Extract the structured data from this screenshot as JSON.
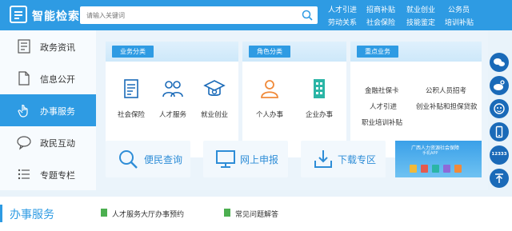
{
  "header": {
    "title": "智能检索",
    "search_placeholder": "请输入关键词",
    "links": [
      "人才引进",
      "招商补贴",
      "就业创业",
      "公务员",
      "劳动关系",
      "社会保险",
      "技能鉴定",
      "培训补贴"
    ]
  },
  "leftnav": {
    "items": [
      {
        "label": "政务资讯",
        "icon": "document-list-icon"
      },
      {
        "label": "信息公开",
        "icon": "file-icon"
      },
      {
        "label": "办事服务",
        "icon": "hand-pointer-icon"
      },
      {
        "label": "政民互动",
        "icon": "chat-bubble-icon"
      },
      {
        "label": "专题专栏",
        "icon": "list-icon"
      }
    ],
    "active": "办事服务"
  },
  "sections": {
    "business": {
      "tag": "业务分类",
      "items": [
        {
          "label": "社会保险",
          "icon": "insurance-doc-icon"
        },
        {
          "label": "人才服务",
          "icon": "people-group-icon"
        },
        {
          "label": "就业创业",
          "icon": "graduate-cap-icon"
        }
      ]
    },
    "role": {
      "tag": "角色分类",
      "items": [
        {
          "label": "个人办事",
          "icon": "person-icon"
        },
        {
          "label": "企业办事",
          "icon": "building-icon"
        }
      ]
    },
    "key": {
      "tag": "重点业务",
      "items": [
        "金融社保卡",
        "公积人员招考",
        "人才引进",
        "创业补贴和担保贷款",
        "职业培训补贴"
      ]
    }
  },
  "quick": [
    {
      "label": "便民查询",
      "icon": "search-icon"
    },
    {
      "label": "网上申报",
      "icon": "computer-icon"
    },
    {
      "label": "下载专区",
      "icon": "download-icon"
    }
  ],
  "banner": {
    "title": "广西人力资源社会保障",
    "subtitle": "手机APP"
  },
  "floatbar": {
    "items": [
      "wechat-icon",
      "weibo-icon",
      "robot-icon",
      "mobile-icon",
      "hotline-icon",
      "back-to-top-icon"
    ],
    "hotline": "12333"
  },
  "bottom": {
    "title": "办事服务",
    "links": [
      "人才服务大厅办事预约",
      "常见问题解答"
    ]
  },
  "colors": {
    "primary": "#2e9be3",
    "dark_blue": "#1a6ab8",
    "accent_orange": "#f08a3a",
    "accent_teal": "#2bb5a6",
    "bg": "#e9f3fa"
  }
}
